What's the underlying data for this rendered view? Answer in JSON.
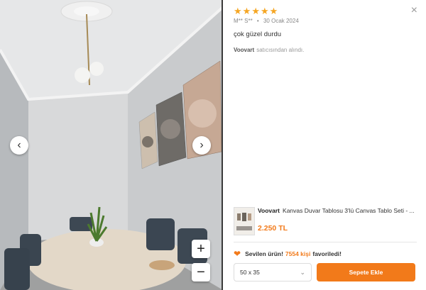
{
  "photo": {
    "prev_icon": "chevron-left-icon",
    "next_icon": "chevron-right-icon",
    "zoom_in_label": "+",
    "zoom_out_label": "−"
  },
  "review": {
    "rating": 5,
    "star_char": "★",
    "author": "M** S**",
    "date": "30 Ocak 2024",
    "comment": "çok güzel durdu",
    "seller_name": "Voovart",
    "seller_suffix": "satıcısından alındı.",
    "close_char": "×"
  },
  "product": {
    "brand": "Voovart",
    "name": "Kanvas Duvar Tablosu 3'lü Canvas Tablo Seti - ...",
    "price": "2.250 TL"
  },
  "favorite": {
    "prefix": "Sevilen ürün!",
    "count": "7554 kişi",
    "suffix": "favoriledi!"
  },
  "actions": {
    "variant": "50 x 35",
    "add_to_cart": "Sepete Ekle"
  },
  "colors": {
    "accent": "#f27a1a",
    "star": "#f5a623"
  }
}
